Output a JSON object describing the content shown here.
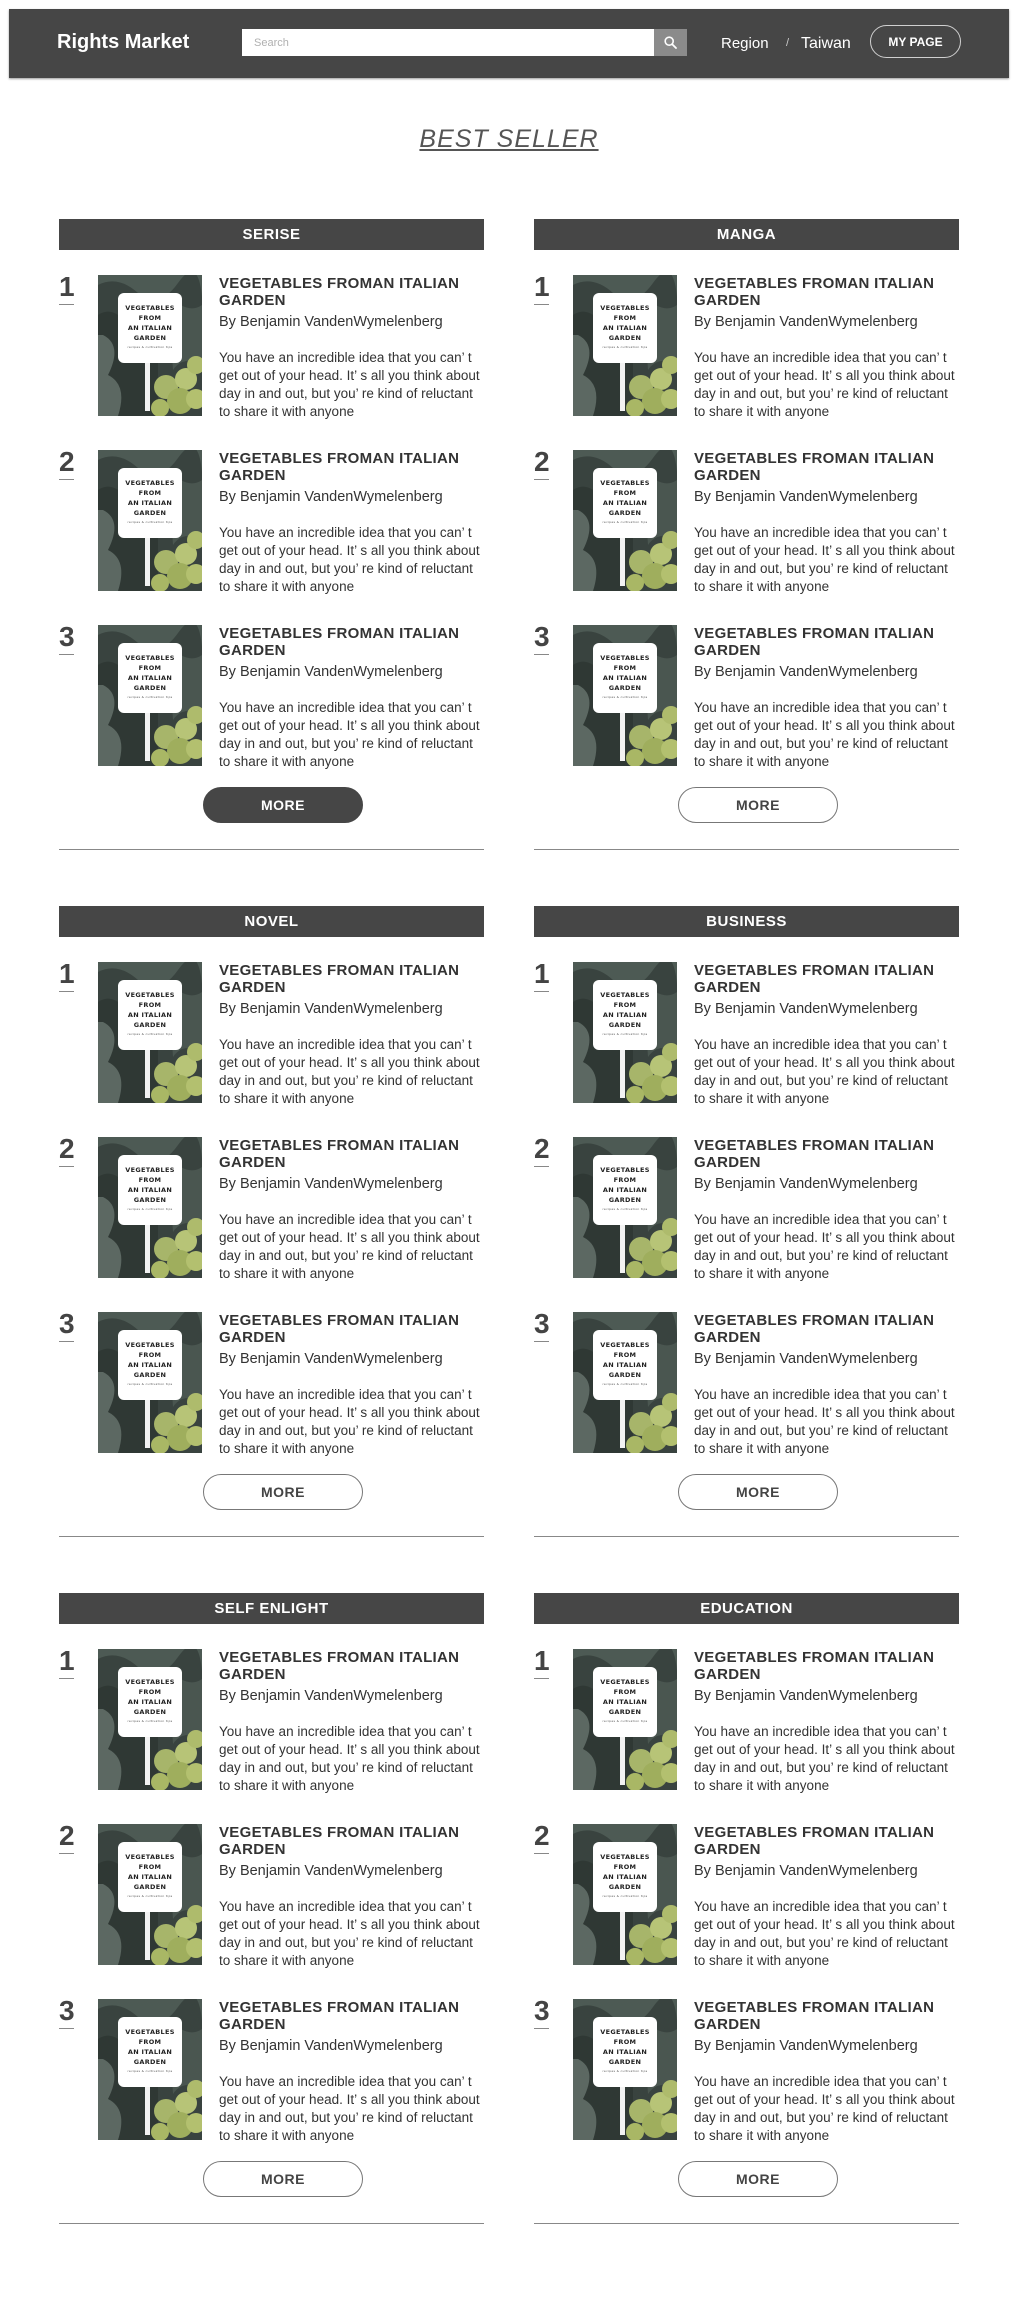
{
  "header": {
    "logo": "Rights Market",
    "search_placeholder": "Search",
    "region_label": "Region",
    "region_separator": "/",
    "region_value": "Taiwan",
    "mypage_label": "MY PAGE"
  },
  "page_title": "BEST SELLER",
  "cover": {
    "lines": [
      "VEGETABLES",
      "FROM",
      "AN ITALIAN",
      "GARDEN"
    ],
    "small": "recipes & cultivation tips"
  },
  "more_label": "MORE",
  "sections": [
    {
      "title": "SERISE",
      "more_active": true,
      "items": [
        {
          "rank": "1",
          "title": "VEGETABLES FROMAN ITALIAN GARDEN",
          "author": "By Benjamin VandenWymelenberg",
          "desc": "You have an incredible idea that you can’ t get out of your head. It’ s all you think about day in and out, but you’ re kind of reluctant to share it with anyone"
        },
        {
          "rank": "2",
          "title": "VEGETABLES FROMAN ITALIAN GARDEN",
          "author": "By Benjamin VandenWymelenberg",
          "desc": "You have an incredible idea that you can’ t get out of your head. It’ s all you think about day in and out, but you’ re kind of reluctant to share it with anyone"
        },
        {
          "rank": "3",
          "title": "VEGETABLES FROMAN ITALIAN GARDEN",
          "author": "By Benjamin VandenWymelenberg",
          "desc": "You have an incredible idea that you can’ t get out of your head. It’ s all you think about day in and out, but you’ re kind of reluctant to share it with anyone"
        }
      ]
    },
    {
      "title": "MANGA",
      "more_active": false,
      "items": [
        {
          "rank": "1",
          "title": "VEGETABLES FROMAN ITALIAN GARDEN",
          "author": "By Benjamin VandenWymelenberg",
          "desc": "You have an incredible idea that you can’ t get out of your head. It’ s all you think about day in and out, but you’ re kind of reluctant to share it with anyone"
        },
        {
          "rank": "2",
          "title": "VEGETABLES FROMAN ITALIAN GARDEN",
          "author": "By Benjamin VandenWymelenberg",
          "desc": "You have an incredible idea that you can’ t get out of your head. It’ s all you think about day in and out, but you’ re kind of reluctant to share it with anyone"
        },
        {
          "rank": "3",
          "title": "VEGETABLES FROMAN ITALIAN GARDEN",
          "author": "By Benjamin VandenWymelenberg",
          "desc": "You have an incredible idea that you can’ t get out of your head. It’ s all you think about day in and out, but you’ re kind of reluctant to share it with anyone"
        }
      ]
    },
    {
      "title": "NOVEL",
      "more_active": false,
      "items": [
        {
          "rank": "1",
          "title": "VEGETABLES FROMAN ITALIAN GARDEN",
          "author": "By Benjamin VandenWymelenberg",
          "desc": "You have an incredible idea that you can’ t get out of your head. It’ s all you think about day in and out, but you’ re kind of reluctant to share it with anyone"
        },
        {
          "rank": "2",
          "title": "VEGETABLES FROMAN ITALIAN GARDEN",
          "author": "By Benjamin VandenWymelenberg",
          "desc": "You have an incredible idea that you can’ t get out of your head. It’ s all you think about day in and out, but you’ re kind of reluctant to share it with anyone"
        },
        {
          "rank": "3",
          "title": "VEGETABLES FROMAN ITALIAN GARDEN",
          "author": "By Benjamin VandenWymelenberg",
          "desc": "You have an incredible idea that you can’ t get out of your head. It’ s all you think about day in and out, but you’ re kind of reluctant to share it with anyone"
        }
      ]
    },
    {
      "title": "BUSINESS",
      "more_active": false,
      "items": [
        {
          "rank": "1",
          "title": "VEGETABLES FROMAN ITALIAN GARDEN",
          "author": "By Benjamin VandenWymelenberg",
          "desc": "You have an incredible idea that you can’ t get out of your head. It’ s all you think about day in and out, but you’ re kind of reluctant to share it with anyone"
        },
        {
          "rank": "2",
          "title": "VEGETABLES FROMAN ITALIAN GARDEN",
          "author": "By Benjamin VandenWymelenberg",
          "desc": "You have an incredible idea that you can’ t get out of your head. It’ s all you think about day in and out, but you’ re kind of reluctant to share it with anyone"
        },
        {
          "rank": "3",
          "title": "VEGETABLES FROMAN ITALIAN GARDEN",
          "author": "By Benjamin VandenWymelenberg",
          "desc": "You have an incredible idea that you can’ t get out of your head. It’ s all you think about day in and out, but you’ re kind of reluctant to share it with anyone"
        }
      ]
    },
    {
      "title": "SELF ENLIGHT",
      "more_active": false,
      "items": [
        {
          "rank": "1",
          "title": "VEGETABLES FROMAN ITALIAN GARDEN",
          "author": "By Benjamin VandenWymelenberg",
          "desc": "You have an incredible idea that you can’ t get out of your head. It’ s all you think about day in and out, but you’ re kind of reluctant to share it with anyone"
        },
        {
          "rank": "2",
          "title": "VEGETABLES FROMAN ITALIAN GARDEN",
          "author": "By Benjamin VandenWymelenberg",
          "desc": "You have an incredible idea that you can’ t get out of your head. It’ s all you think about day in and out, but you’ re kind of reluctant to share it with anyone"
        },
        {
          "rank": "3",
          "title": "VEGETABLES FROMAN ITALIAN GARDEN",
          "author": "By Benjamin VandenWymelenberg",
          "desc": "You have an incredible idea that you can’ t get out of your head. It’ s all you think about day in and out, but you’ re kind of reluctant to share it with anyone"
        }
      ]
    },
    {
      "title": "EDUCATION",
      "more_active": false,
      "items": [
        {
          "rank": "1",
          "title": "VEGETABLES FROMAN ITALIAN GARDEN",
          "author": "By Benjamin VandenWymelenberg",
          "desc": "You have an incredible idea that you can’ t get out of your head. It’ s all you think about day in and out, but you’ re kind of reluctant to share it with anyone"
        },
        {
          "rank": "2",
          "title": "VEGETABLES FROMAN ITALIAN GARDEN",
          "author": "By Benjamin VandenWymelenberg",
          "desc": "You have an incredible idea that you can’ t get out of your head. It’ s all you think about day in and out, but you’ re kind of reluctant to share it with anyone"
        },
        {
          "rank": "3",
          "title": "VEGETABLES FROMAN ITALIAN GARDEN",
          "author": "By Benjamin VandenWymelenberg",
          "desc": "You have an incredible idea that you can’ t get out of your head. It’ s all you think about day in and out, but you’ re kind of reluctant to share it with anyone"
        }
      ]
    }
  ],
  "colors": {
    "header_bg": "#464646",
    "accent_dark": "#464646",
    "search_button": "#8b8b8b"
  }
}
